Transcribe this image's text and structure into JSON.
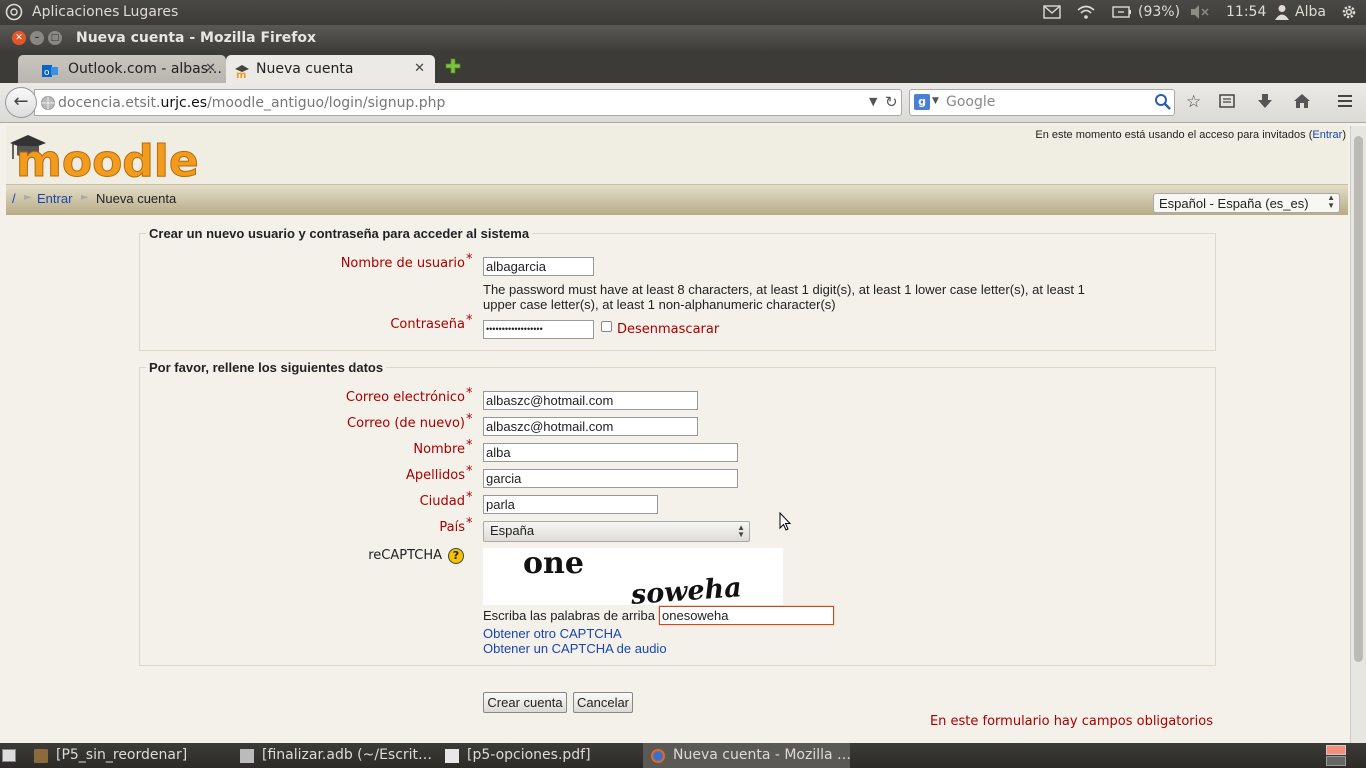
{
  "os_panel": {
    "menu_apps": "Aplicaciones",
    "menu_places": "Lugares",
    "battery": "(93%)",
    "clock": "11:54",
    "user": "Alba"
  },
  "window": {
    "title": "Nueva cuenta - Mozilla Firefox"
  },
  "tabs": [
    {
      "label": "Outlook.com - albas…"
    },
    {
      "label": "Nueva cuenta"
    }
  ],
  "url": {
    "host_prefix": "docencia.etsit.",
    "host_domain": "urjc.es",
    "path": "/moodle_antiguo/login/signup.php"
  },
  "search": {
    "placeholder": "Google"
  },
  "page": {
    "logo_text": "moodle",
    "guest_notice": "En este momento está usando el acceso para invitados (",
    "guest_login_link": "Entrar",
    "guest_notice_end": ")",
    "breadcrumb": {
      "home": "/",
      "login": "Entrar",
      "current": "Nueva cuenta"
    },
    "language_select": "Español - España (es_es)",
    "section1": {
      "legend": "Crear un nuevo usuario y contraseña para acceder al sistema",
      "username_label": "Nombre de usuario",
      "username_value": "albagarcia",
      "password_policy_line1": "The password must have at least 8 characters, at least 1 digit(s), at least 1 lower case letter(s), at least 1",
      "password_policy_line2": "upper case letter(s), at least 1 non-alphanumeric character(s)",
      "password_label": "Contraseña",
      "password_value": "••••••••••••••••••",
      "unmask_label": "Desenmascarar"
    },
    "section2": {
      "legend": "Por favor, rellene los siguientes datos",
      "email_label": "Correo electrónico",
      "email_value": "albaszc@hotmail.com",
      "email2_label": "Correo (de nuevo)",
      "email2_value": "albaszc@hotmail.com",
      "firstname_label": "Nombre",
      "firstname_value": "alba",
      "lastname_label": "Apellidos",
      "lastname_value": "garcia",
      "city_label": "Ciudad",
      "city_value": "parla",
      "country_label": "País",
      "country_value": "España",
      "recaptcha_label": "reCAPTCHA",
      "captcha_word1": "one",
      "captcha_word2": "soweha",
      "captcha_prompt": "Escriba las palabras de arriba",
      "captcha_value": "onesoweha",
      "captcha_other": "Obtener otro CAPTCHA",
      "captcha_audio": "Obtener un CAPTCHA de audio"
    },
    "create_button": "Crear cuenta",
    "cancel_button": "Cancelar",
    "required_notice": "En este formulario hay campos obligatorios"
  },
  "taskbar": [
    {
      "label": "[P5_sin_reordenar]"
    },
    {
      "label": "[finalizar.adb (~/Escrit…"
    },
    {
      "label": "[p5-opciones.pdf]"
    },
    {
      "label": "Nueva cuenta - Mozilla …"
    }
  ],
  "colors": {
    "required": "#aa0000",
    "link": "#1a46b0",
    "moodle_orange": "#f29b1c"
  }
}
